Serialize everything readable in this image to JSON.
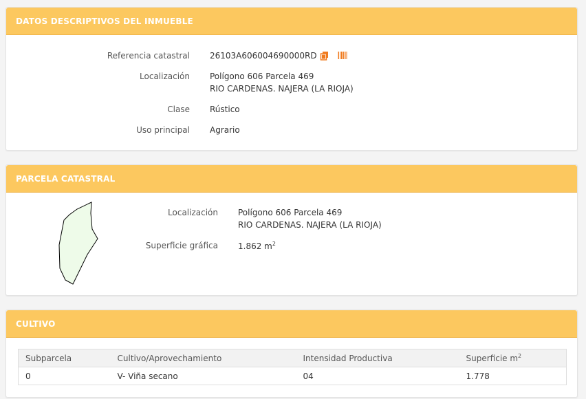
{
  "inmueble": {
    "title": "DATOS DESCRIPTIVOS DEL INMUEBLE",
    "referencia_label": "Referencia catastral",
    "referencia_value": "26103A606004690000RD",
    "localizacion_label": "Localización",
    "localizacion_line1": "Polígono 606 Parcela 469",
    "localizacion_line2": "RIO CARDENAS. NAJERA (LA RIOJA)",
    "clase_label": "Clase",
    "clase_value": "Rústico",
    "uso_label": "Uso principal",
    "uso_value": "Agrario",
    "icons": [
      "copy-icon",
      "barcode-icon"
    ]
  },
  "parcela": {
    "title": "PARCELA CATASTRAL",
    "localizacion_label": "Localización",
    "localizacion_line1": "Polígono 606 Parcela 469",
    "localizacion_line2": "RIO CARDENAS. NAJERA (LA RIOJA)",
    "superficie_label": "Superficie gráfica",
    "superficie_value": "1.862 m",
    "superficie_unit_sup": "2",
    "shape_fill": "#eefbe9"
  },
  "cultivo": {
    "title": "CULTIVO",
    "columns": [
      "Subparcela",
      "Cultivo/Aprovechamiento",
      "Intensidad Productiva",
      "Superficie m"
    ],
    "superficie_sup": "2",
    "rows": [
      [
        "0",
        "V- Viña secano",
        "04",
        "1.778"
      ]
    ]
  },
  "colors": {
    "header": "#fcc85f",
    "icon_accent": "#f07b1f"
  }
}
